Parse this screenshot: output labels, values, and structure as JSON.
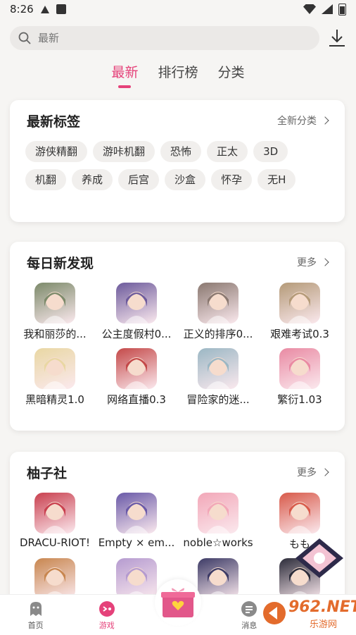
{
  "status": {
    "time": "8:26"
  },
  "search": {
    "placeholder": "最新"
  },
  "tabs": [
    {
      "label": "最新",
      "active": true
    },
    {
      "label": "排行榜",
      "active": false
    },
    {
      "label": "分类",
      "active": false
    }
  ],
  "tags_card": {
    "title": "最新标签",
    "more": "全新分类",
    "tags": [
      "游侠精翻",
      "游咔机翻",
      "恐怖",
      "正太",
      "3D",
      "机翻",
      "养成",
      "后宫",
      "沙盒",
      "怀孕",
      "无H"
    ]
  },
  "daily_card": {
    "title": "每日新发现",
    "more": "更多",
    "games": [
      {
        "name": "我和丽莎的...",
        "color": "#7c8a6a"
      },
      {
        "name": "公主度假村0...",
        "color": "#6d5b9c"
      },
      {
        "name": "正义的排序0...",
        "color": "#8a7870"
      },
      {
        "name": "艰难考试0.3",
        "color": "#b49a78"
      },
      {
        "name": "黑暗精灵1.0",
        "color": "#e9d7a3"
      },
      {
        "name": "网络直播0.3",
        "color": "#c44949"
      },
      {
        "name": "冒险家的迷...",
        "color": "#9bb7c4"
      },
      {
        "name": "繁衍1.03",
        "color": "#e98aa3"
      }
    ]
  },
  "yuzu_card": {
    "title": "柚子社",
    "more": "更多",
    "games": [
      {
        "name": "DRACU-RIOT!",
        "color": "#c9404f"
      },
      {
        "name": "Empty × em...",
        "color": "#6a5aa8"
      },
      {
        "name": "noble☆works",
        "color": "#f2a7b8"
      },
      {
        "name": "もも",
        "color": "#d85a4a"
      },
      {
        "name": "",
        "color": "#c8864f"
      },
      {
        "name": "",
        "color": "#b59bd0"
      },
      {
        "name": "",
        "color": "#3d3b66"
      },
      {
        "name": "",
        "color": "#2c2c3a"
      }
    ]
  },
  "nav": {
    "home": "首页",
    "games": "游戏",
    "messages": "消息"
  },
  "watermark": "962.NET",
  "watermark_sub": "乐游网",
  "colors": {
    "accent": "#e5427a"
  }
}
